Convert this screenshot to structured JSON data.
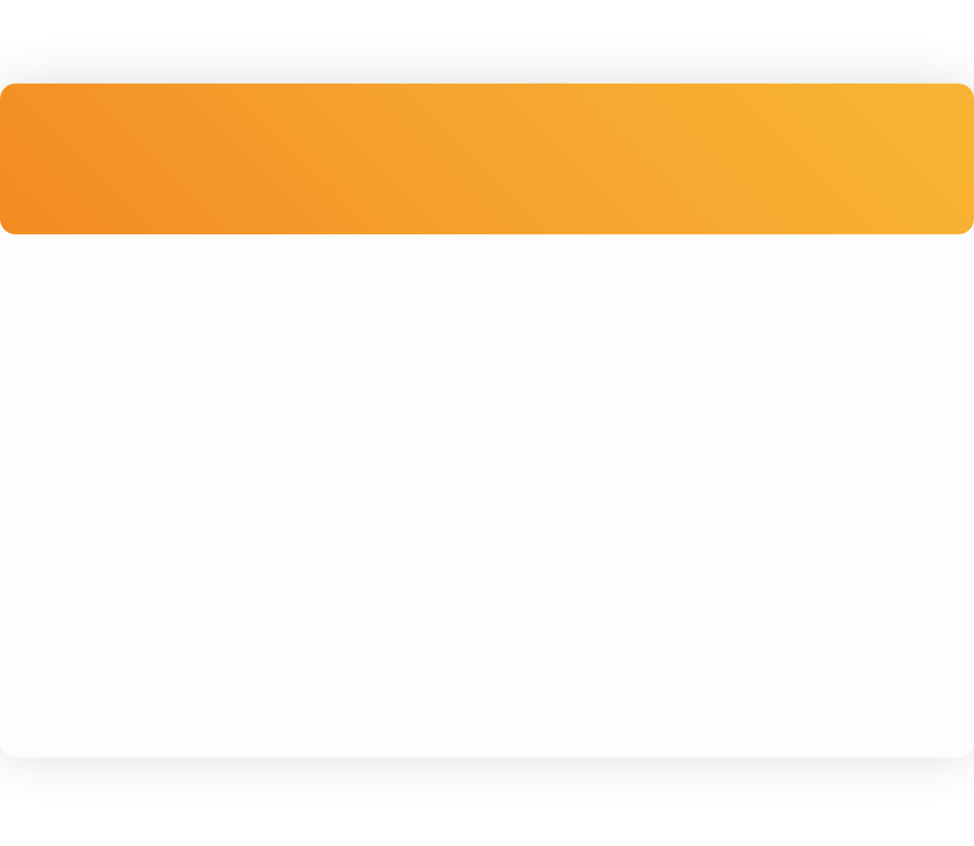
{
  "card": {
    "header_gradient": [
      "#f28a22",
      "#f6a42f",
      "#f8b534"
    ],
    "body_color": "#fdfdfd"
  }
}
